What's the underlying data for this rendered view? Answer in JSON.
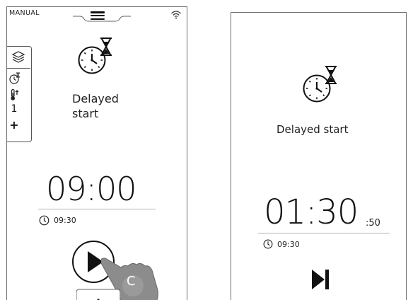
{
  "left_screen": {
    "mode": "MANUAL",
    "icons": {
      "menu": "hamburger-menu-icon",
      "wifi": "wifi-icon",
      "layers": "layers-icon",
      "timer": "timer-icon",
      "temperature": "thermometer-icon",
      "add": "plus-icon",
      "play": "play-icon"
    },
    "side_panel": {
      "level": "1",
      "add_label": "+"
    },
    "title": "Delayed\nstart",
    "time": "09:00",
    "end_time": "09:30",
    "touch_marker": "C"
  },
  "right_screen": {
    "title": "Delayed start",
    "time": "01:30",
    "seconds": ":50",
    "end_time": "09:30",
    "icons": {
      "skip": "skip-next-icon"
    }
  }
}
